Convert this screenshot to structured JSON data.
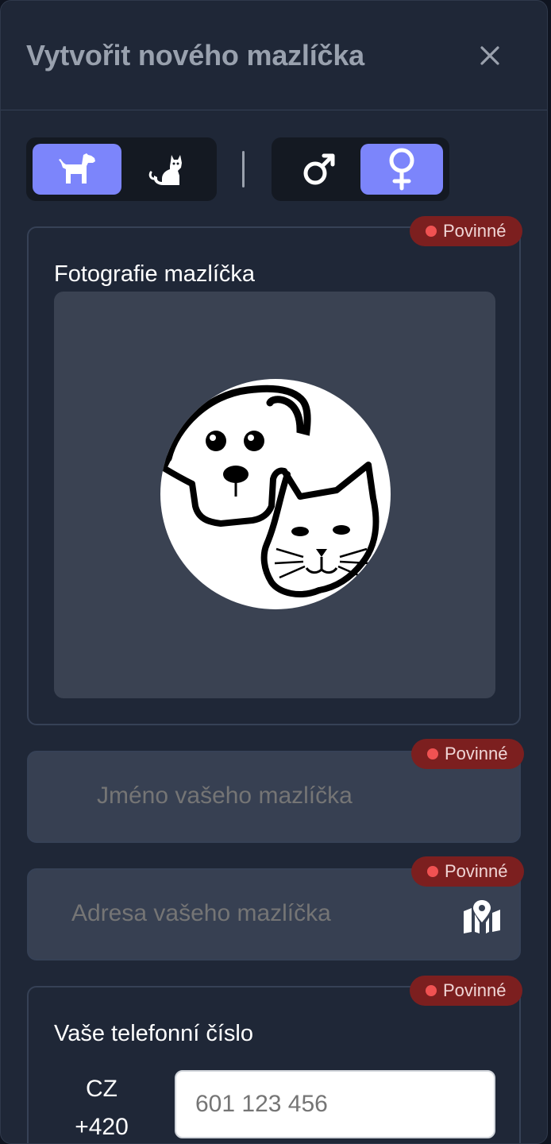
{
  "modal": {
    "title": "Vytvořit nového mazlíčka",
    "close_icon": "close-icon"
  },
  "species_toggle": {
    "options": [
      "dog-icon",
      "cat-icon"
    ],
    "selected": "dog"
  },
  "gender_toggle": {
    "options": [
      "male-icon",
      "female-icon"
    ],
    "selected": "female"
  },
  "photo": {
    "label": "Fotografie mazlíčka",
    "required_badge": "Povinné"
  },
  "name_field": {
    "placeholder": "Jméno vašeho mazlíčka",
    "required_badge": "Povinné"
  },
  "address_field": {
    "placeholder": "Adresa vašeho mazlíčka",
    "required_badge": "Povinné",
    "icon": "map-pin-icon"
  },
  "phone": {
    "label": "Vaše telefonní číslo",
    "country": "CZ",
    "dial_code": "+420",
    "placeholder": "601 123 456",
    "required_badge": "Povinné"
  },
  "colors": {
    "accent": "#7c85fb",
    "required": "#7c1f1f",
    "panel": "#1f2737"
  }
}
